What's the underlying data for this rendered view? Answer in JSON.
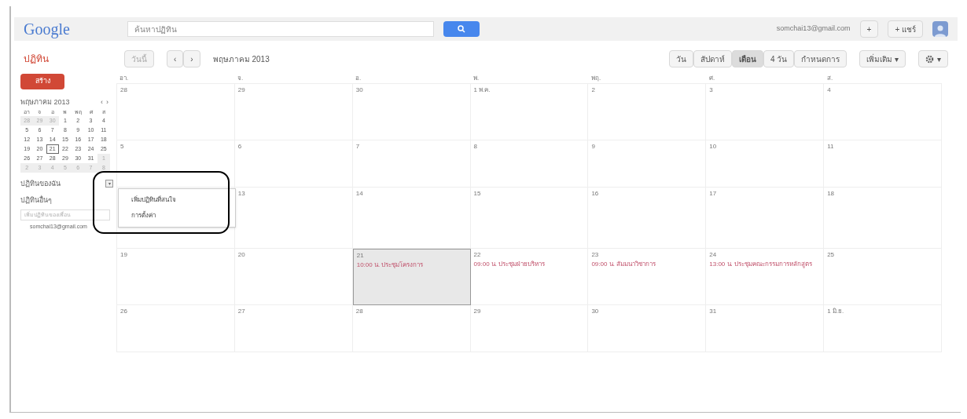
{
  "header": {
    "logo": "Google",
    "search": {
      "placeholder": "ค้นหาปฏิทิน"
    },
    "account": "somchai13@gmail.com",
    "buttons": [
      "+",
      "+ แชร์"
    ]
  },
  "toolbar": {
    "title": "ปฏิทิน",
    "today": "วันนี้",
    "prev": "‹",
    "next": "›",
    "period": "พฤษภาคม 2013",
    "views": [
      {
        "label": "วัน",
        "selected": false
      },
      {
        "label": "สัปดาห์",
        "selected": false
      },
      {
        "label": "เดือน",
        "selected": true
      },
      {
        "label": "4 วัน",
        "selected": false
      },
      {
        "label": "กำหนดการ",
        "selected": false
      }
    ],
    "more": "เพิ่มเติม ▾",
    "settings": "▾"
  },
  "sidebar": {
    "create": "สร้าง",
    "mini_calendar": {
      "title": "พฤษภาคม 2013",
      "prev": "‹",
      "next": "›",
      "weekdays": [
        "อา",
        "จ",
        "อ",
        "พ",
        "พฤ",
        "ศ",
        "ส"
      ],
      "weeks": [
        [
          {
            "d": "28",
            "other": true,
            "selected": false
          },
          {
            "d": "29",
            "other": true,
            "selected": false
          },
          {
            "d": "30",
            "other": true,
            "selected": false
          },
          {
            "d": "1",
            "other": false,
            "selected": false
          },
          {
            "d": "2",
            "other": false,
            "selected": false
          },
          {
            "d": "3",
            "other": false,
            "selected": false
          },
          {
            "d": "4",
            "other": false,
            "selected": false
          }
        ],
        [
          {
            "d": "5",
            "other": false,
            "selected": false
          },
          {
            "d": "6",
            "other": false,
            "selected": false
          },
          {
            "d": "7",
            "other": false,
            "selected": false
          },
          {
            "d": "8",
            "other": false,
            "selected": false
          },
          {
            "d": "9",
            "other": false,
            "selected": false
          },
          {
            "d": "10",
            "other": false,
            "selected": false
          },
          {
            "d": "11",
            "other": false,
            "selected": false
          }
        ],
        [
          {
            "d": "12",
            "other": false,
            "selected": false
          },
          {
            "d": "13",
            "other": false,
            "selected": false
          },
          {
            "d": "14",
            "other": false,
            "selected": false
          },
          {
            "d": "15",
            "other": false,
            "selected": false
          },
          {
            "d": "16",
            "other": false,
            "selected": false
          },
          {
            "d": "17",
            "other": false,
            "selected": false
          },
          {
            "d": "18",
            "other": false,
            "selected": false
          }
        ],
        [
          {
            "d": "19",
            "other": false,
            "selected": false
          },
          {
            "d": "20",
            "other": false,
            "selected": false
          },
          {
            "d": "21",
            "other": false,
            "selected": true
          },
          {
            "d": "22",
            "other": false,
            "selected": false
          },
          {
            "d": "23",
            "other": false,
            "selected": false
          },
          {
            "d": "24",
            "other": false,
            "selected": false
          },
          {
            "d": "25",
            "other": false,
            "selected": false
          }
        ],
        [
          {
            "d": "26",
            "other": false,
            "selected": false
          },
          {
            "d": "27",
            "other": false,
            "selected": false
          },
          {
            "d": "28",
            "other": false,
            "selected": false
          },
          {
            "d": "29",
            "other": false,
            "selected": false
          },
          {
            "d": "30",
            "other": false,
            "selected": false
          },
          {
            "d": "31",
            "other": false,
            "selected": false
          },
          {
            "d": "1",
            "other": true,
            "selected": false
          }
        ],
        [
          {
            "d": "2",
            "other": true,
            "selected": false
          },
          {
            "d": "3",
            "other": true,
            "selected": false
          },
          {
            "d": "4",
            "other": true,
            "selected": false
          },
          {
            "d": "5",
            "other": true,
            "selected": false
          },
          {
            "d": "6",
            "other": true,
            "selected": false
          },
          {
            "d": "7",
            "other": true,
            "selected": false
          },
          {
            "d": "8",
            "other": true,
            "selected": false
          }
        ]
      ]
    },
    "sections": [
      {
        "label": "ปฏิทินของฉัน",
        "menu_button": "▾",
        "menu_open": true
      },
      {
        "label": "ปฏิทินอื่นๆ"
      }
    ],
    "add_field": {
      "placeholder": "เพิ่มปฏิทินของเพื่อน"
    },
    "calendar_entry": "somchai13@gmail.com",
    "menu": [
      "เพิ่มปฏิทินที่สนใจ",
      "การตั้งค่า"
    ]
  },
  "month": {
    "weekdays": [
      "อา.",
      "จ.",
      "อ.",
      "พ.",
      "พฤ.",
      "ศ.",
      "ส."
    ],
    "weeks": [
      [
        {
          "label": "28",
          "selected": false
        },
        {
          "label": "29",
          "selected": false
        },
        {
          "label": "30",
          "selected": false
        },
        {
          "label": "1 พ.ค.",
          "selected": false
        },
        {
          "label": "2",
          "selected": false
        },
        {
          "label": "3",
          "selected": false
        },
        {
          "label": "4",
          "selected": false
        }
      ],
      [
        {
          "label": "5",
          "selected": false
        },
        {
          "label": "6",
          "selected": false
        },
        {
          "label": "7",
          "selected": false
        },
        {
          "label": "8",
          "selected": false
        },
        {
          "label": "9",
          "selected": false
        },
        {
          "label": "10",
          "selected": false
        },
        {
          "label": "11",
          "selected": false
        }
      ],
      [
        {
          "selected": false
        },
        {
          "label": "13",
          "selected": false
        },
        {
          "label": "14",
          "selected": false
        },
        {
          "label": "15",
          "selected": false
        },
        {
          "label": "16",
          "selected": false
        },
        {
          "label": "17",
          "selected": false
        },
        {
          "label": "18",
          "selected": false
        }
      ],
      [
        {
          "label": "19",
          "selected": false
        },
        {
          "label": "20",
          "selected": false
        },
        {
          "label": "21",
          "selected": true,
          "events": [
            "10:00 น. ประชุมโครงการ"
          ]
        },
        {
          "label": "22",
          "selected": false,
          "events": [
            "09:00 น. ประชุมฝ่ายบริหาร"
          ]
        },
        {
          "label": "23",
          "selected": false,
          "events": [
            "09:00 น. สัมมนาวิชาการ"
          ]
        },
        {
          "label": "24",
          "selected": false,
          "events": [
            "13:00 น. ประชุมคณะกรรมการหลักสูตร"
          ]
        },
        {
          "label": "25",
          "selected": false
        }
      ],
      [
        {
          "label": "26",
          "selected": false
        },
        {
          "label": "27",
          "selected": false
        },
        {
          "label": "28",
          "selected": false
        },
        {
          "label": "29",
          "selected": false
        },
        {
          "label": "30",
          "selected": false
        },
        {
          "label": "31",
          "selected": false
        },
        {
          "label": "1 มิ.ย.",
          "selected": false
        }
      ]
    ]
  }
}
